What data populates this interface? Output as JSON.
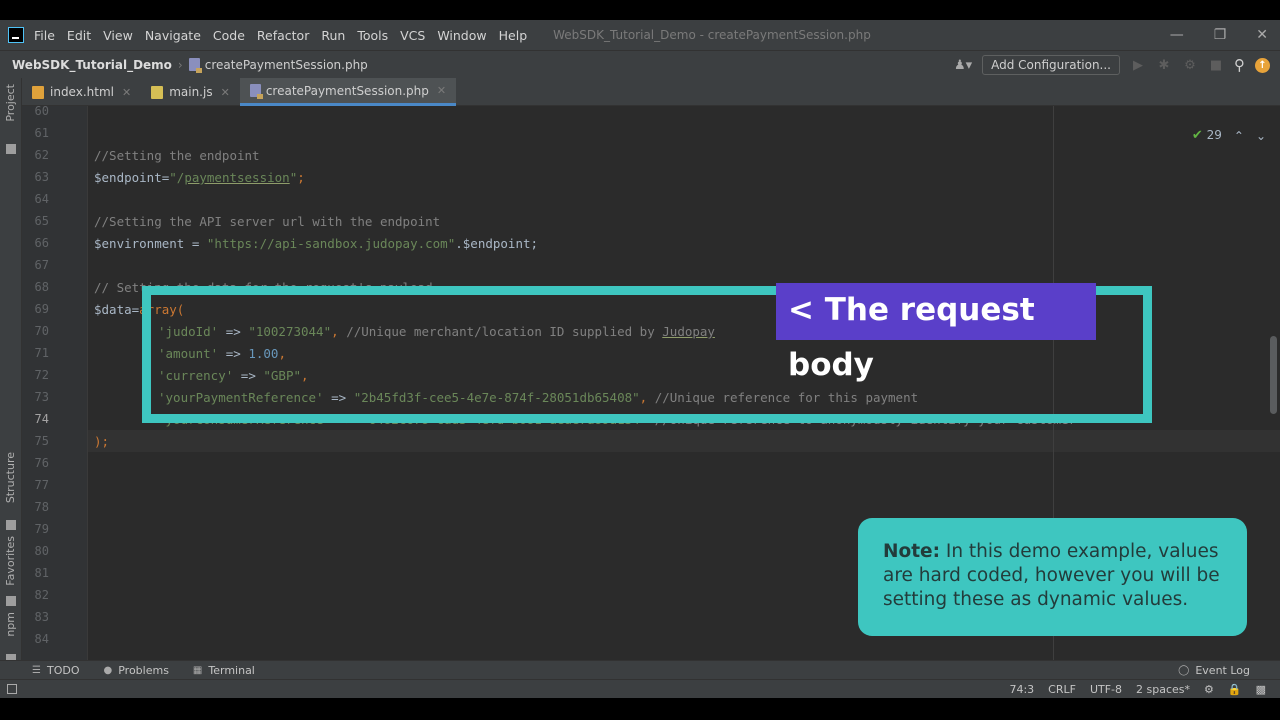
{
  "menubar": {
    "items": [
      "File",
      "Edit",
      "View",
      "Navigate",
      "Code",
      "Refactor",
      "Run",
      "Tools",
      "VCS",
      "Window",
      "Help"
    ],
    "window_title": "WebSDK_Tutorial_Demo - createPaymentSession.php"
  },
  "navbar": {
    "project": "WebSDK_Tutorial_Demo",
    "file": "createPaymentSession.php",
    "add_configuration": "Add Configuration..."
  },
  "sidebar": {
    "project": "Project",
    "structure": "Structure",
    "favorites": "Favorites",
    "npm": "npm"
  },
  "tabs": [
    {
      "label": "index.html"
    },
    {
      "label": "main.js"
    },
    {
      "label": "createPaymentSession.php"
    }
  ],
  "editor": {
    "inspection_count": "29",
    "line_numbers": [
      "60",
      "61",
      "62",
      "63",
      "64",
      "65",
      "66",
      "67",
      "68",
      "69",
      "70",
      "71",
      "72",
      "73",
      "74",
      "75",
      "76",
      "77",
      "78",
      "79",
      "80",
      "81",
      "82",
      "83",
      "84"
    ],
    "lines": {
      "l61": "//Setting the endpoint",
      "l62_var": "$endpoint=",
      "l62_str_open": "\"/",
      "l62_str_word": "paymentsession",
      "l62_str_close": "\"",
      "l62_end": ";",
      "l64": "//Setting the API server url with the endpoint",
      "l65_var": "$environment = ",
      "l65_str": "\"https://api-sandbox.judopay.com\"",
      "l65_end": ".$endpoint;",
      "l67": "// Setting the data for the request's payload",
      "l68_var": "$data=",
      "l68_kw": "array(",
      "l69_key": "'judoId'",
      "l69_op": " => ",
      "l69_val": "\"100273044\"",
      "l69_sep": ", ",
      "l69_cm": "//Unique merchant/location ID supplied by ",
      "l69_cm_word": "Judopay",
      "l70_key": "'amount'",
      "l70_op": " => ",
      "l70_val": "1.00",
      "l70_end": ",",
      "l71_key": "'currency'",
      "l71_op": " => ",
      "l71_val": "\"GBP\"",
      "l71_end": ",",
      "l72_key": "'yourPaymentReference'",
      "l72_op": " => ",
      "l72_val": "\"2b45fd3f-cee5-4e7e-874f-28051db65408\"",
      "l72_sep": ", ",
      "l72_cm": "//Unique reference for this payment",
      "l73_key": "'yourConsumerReference'",
      "l73_op": " => ",
      "l73_val": "\"6482c678-cad3-4efd-b081-aeae7a89a134\"",
      "l73_sep": " ",
      "l73_cm": "//Unique reference to anonymously identify your customer",
      "l74": ");"
    }
  },
  "overlay": {
    "callout": "< The request body",
    "note_label": "Note:",
    "note_text": " In this demo example, values are hard coded, however you will be setting these as dynamic values."
  },
  "toolwindows": {
    "todo": "TODO",
    "problems": "Problems",
    "terminal": "Terminal",
    "event_log": "Event Log"
  },
  "statusbar": {
    "position": "74:3",
    "line_ending": "CRLF",
    "encoding": "UTF-8",
    "indent": "2 spaces*"
  },
  "colors": {
    "accent_teal": "#3ec6c0",
    "callout_purple": "#5a3fc9",
    "editor_bg": "#2b2b2b"
  }
}
